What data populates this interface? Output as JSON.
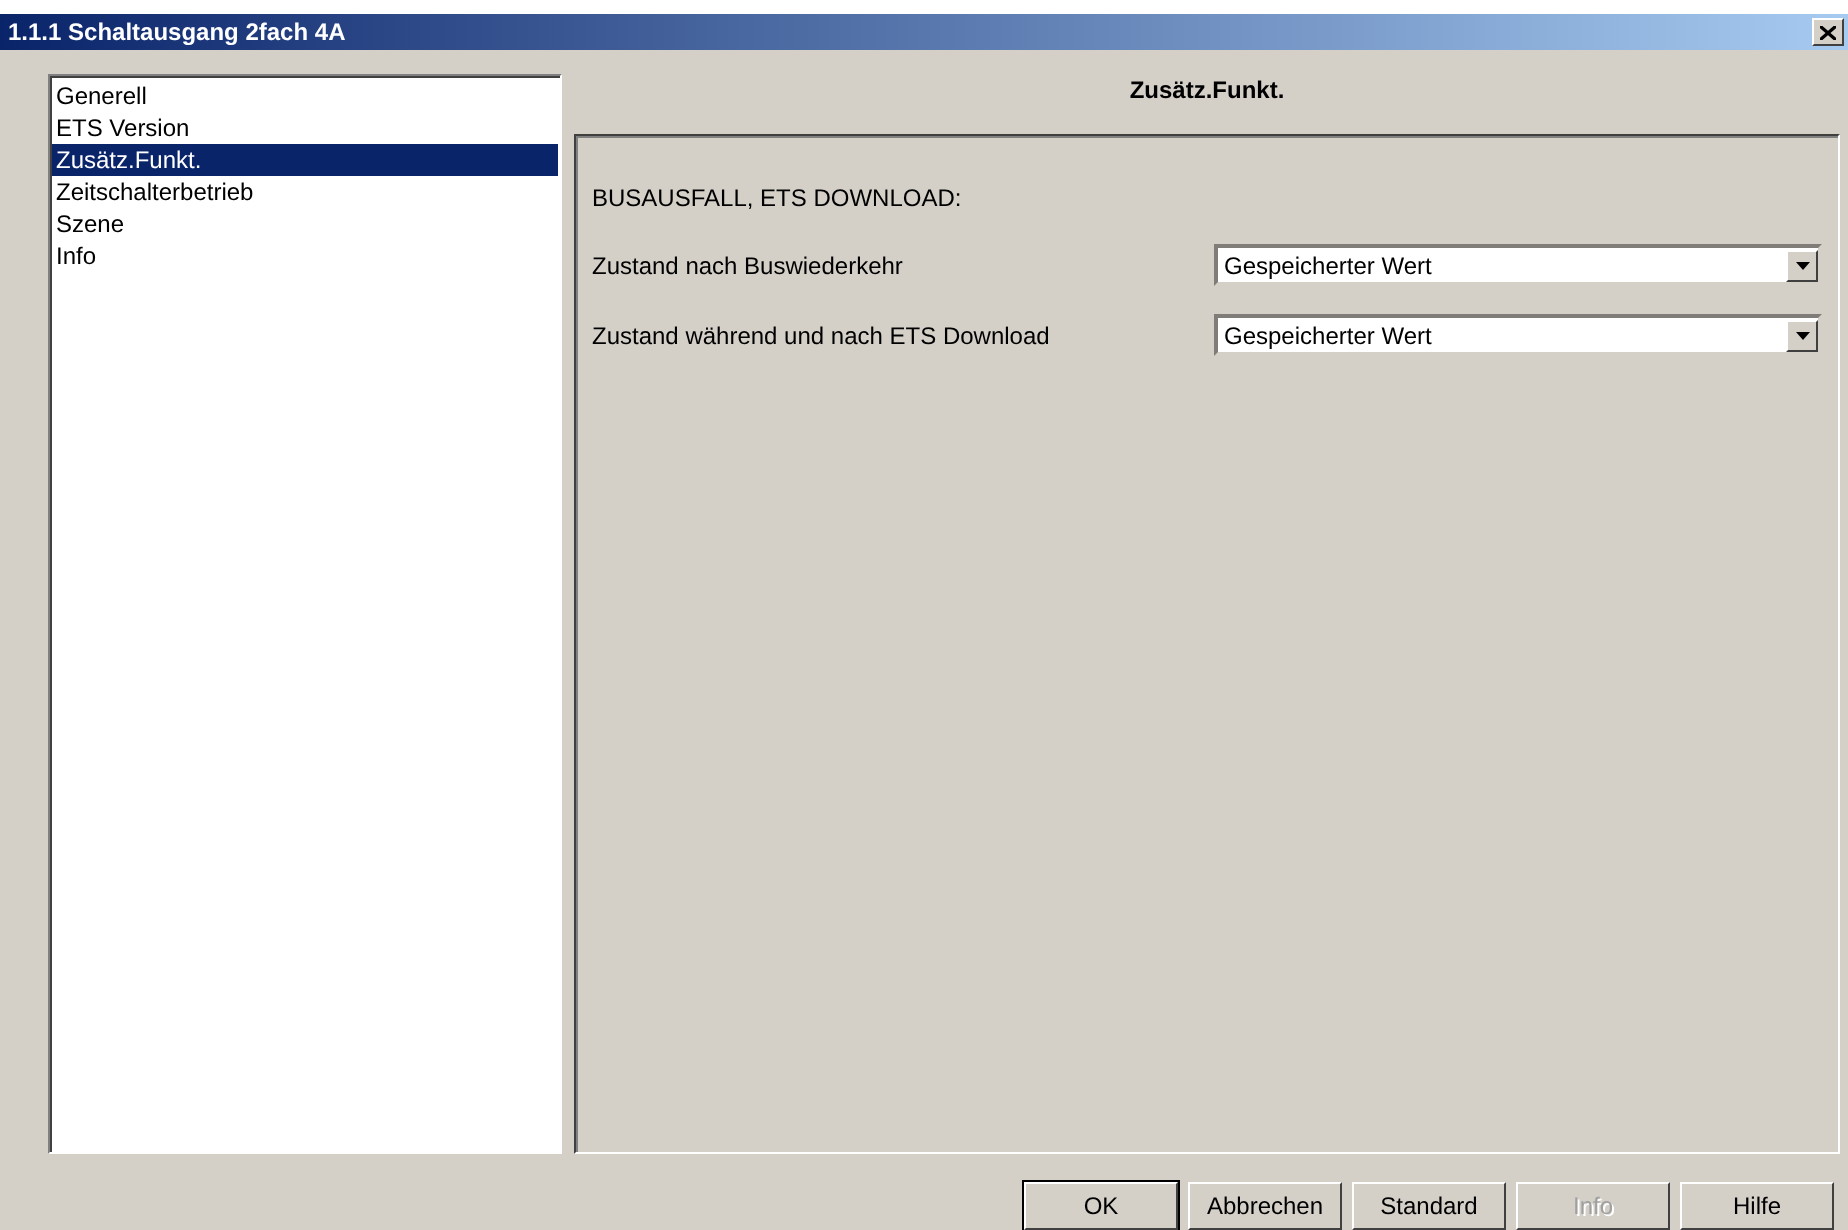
{
  "window": {
    "title": "1.1.1 Schaltausgang 2fach 4A"
  },
  "sidebar": {
    "items": [
      {
        "label": "Generell",
        "selected": false
      },
      {
        "label": "ETS Version",
        "selected": false
      },
      {
        "label": "Zusätz.Funkt.",
        "selected": true
      },
      {
        "label": "Zeitschalterbetrieb",
        "selected": false
      },
      {
        "label": "Szene",
        "selected": false
      },
      {
        "label": "Info",
        "selected": false
      }
    ]
  },
  "page": {
    "title": "Zusätz.Funkt.",
    "section": "BUSAUSFALL, ETS DOWNLOAD:",
    "parameters": [
      {
        "label": "Zustand nach Buswiederkehr",
        "value": "Gespeicherter Wert"
      },
      {
        "label": "Zustand während und nach ETS Download",
        "value": "Gespeicherter Wert"
      }
    ]
  },
  "buttons": [
    {
      "label": "OK",
      "default": true,
      "disabled": false
    },
    {
      "label": "Abbrechen",
      "default": false,
      "disabled": false
    },
    {
      "label": "Standard",
      "default": false,
      "disabled": false
    },
    {
      "label": "Info",
      "default": false,
      "disabled": true
    },
    {
      "label": "Hilfe",
      "default": false,
      "disabled": false
    }
  ]
}
